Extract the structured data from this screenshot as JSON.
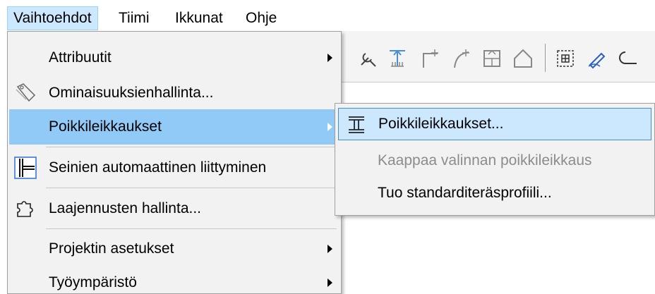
{
  "menubar": {
    "items": [
      {
        "label": "Vaihtoehdot",
        "active": true
      },
      {
        "label": "Tiimi",
        "active": false
      },
      {
        "label": "Ikkunat",
        "active": false
      },
      {
        "label": "Ohje",
        "active": false
      }
    ]
  },
  "toolbar": {
    "icons": [
      "wrench-icon",
      "dimension-up-icon",
      "corner-icon",
      "curve-icon",
      "box-arrow-icon",
      "house-icon",
      "grid-select-icon",
      "pen-icon",
      "cloud-icon"
    ]
  },
  "menu": {
    "items": [
      {
        "label": "Attribuutit",
        "has_submenu": true
      },
      {
        "label": "Ominaisuuksienhallinta...",
        "has_submenu": false,
        "icon": "tag-icon"
      },
      {
        "label": "Poikkileikkaukset",
        "has_submenu": true,
        "highlighted": true
      },
      {
        "label": "Seinien automaattinen liittyminen",
        "has_submenu": false,
        "icon": "wall-join-icon"
      },
      {
        "label": "Laajennusten hallinta...",
        "has_submenu": false,
        "icon": "puzzle-icon"
      },
      {
        "label": "Projektin asetukset",
        "has_submenu": true
      },
      {
        "label": "Työympäristö",
        "has_submenu": true
      }
    ]
  },
  "submenu": {
    "items": [
      {
        "label": "Poikkileikkaukset...",
        "highlighted": true,
        "icon": "i-beam-icon"
      },
      {
        "label": "Kaappaa valinnan poikkileikkaus",
        "disabled": true
      },
      {
        "label": "Tuo standarditeräsprofiili...",
        "disabled": false
      }
    ]
  },
  "colors": {
    "menu_bg": "#f2f2f2",
    "highlight": "#91c9f7",
    "submenu_highlight": "#cce8ff",
    "submenu_highlight_border": "#3d8fd6",
    "disabled_text": "#8c8c8c"
  }
}
